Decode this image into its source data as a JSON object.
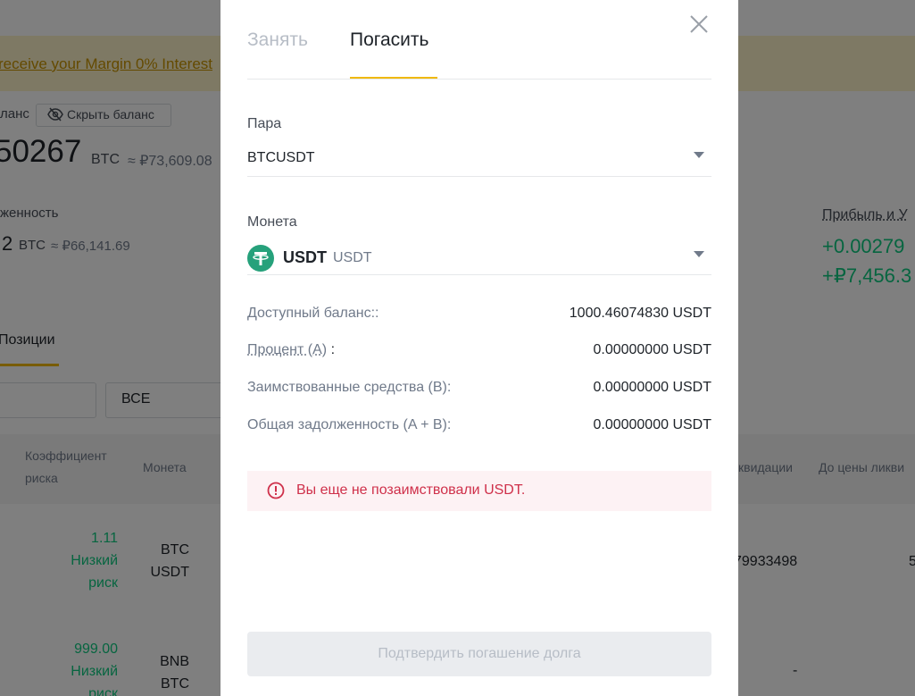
{
  "background": {
    "banner_text": "receive your Margin 0% Interest",
    "balance_label": "ланс",
    "hide_balance_label": "Скрыть баланс",
    "balance_value": "50267",
    "balance_unit": "BTC",
    "balance_fiat": "≈ ₽73,609.08",
    "debt_label": "женность",
    "debt_value": "2",
    "debt_unit": "BTC",
    "debt_fiat": "≈ ₽66,141.69",
    "pnl_label": "Прибыль и У",
    "pnl_btc": "+0.00279",
    "pnl_fiat": "+₽7,456.3",
    "positions_tab": "Позиции",
    "filter_value": "ВСЕ",
    "columns": {
      "risk_line1": "Коэффициент",
      "risk_line2": "риска",
      "coin": "Монета",
      "liquidation": "квидации",
      "to_liq": "До цены ликви"
    },
    "rows": [
      {
        "ratio": "1.11",
        "risk1": "Низкий",
        "risk2": "риск",
        "coin1": "BTC",
        "coin2": "USDT",
        "liq": "79933498",
        "extra": "5"
      },
      {
        "ratio": "999.00",
        "risk1": "Низкий",
        "risk2": "риск",
        "coin1": "BNB",
        "coin2": "BTC",
        "liq": "-"
      }
    ]
  },
  "modal": {
    "tabs": [
      "Занять",
      "Погасить"
    ],
    "active_tab": 1,
    "pair_label": "Пара",
    "pair_value": "BTCUSDT",
    "coin_label": "Монета",
    "coin_name": "USDT",
    "coin_ticker": "USDT",
    "rows": [
      {
        "label": "Доступный баланс::",
        "value": "1000.46074830 USDT"
      },
      {
        "label_main": "Процент (A)",
        "label_suffix": " :",
        "value": "0.00000000 USDT"
      },
      {
        "label": "Заимствованные средства (B):",
        "value": "0.00000000 USDT"
      },
      {
        "label": "Общая задолженность (A + B):",
        "value": "0.00000000 USDT"
      }
    ],
    "warning": "Вы еще не позаимствовали USDT.",
    "confirm_label": "Подтвердить погашение долга",
    "colors": {
      "accent": "#F0B90B",
      "tether": "#26A17B",
      "error": "#CF304A"
    }
  }
}
